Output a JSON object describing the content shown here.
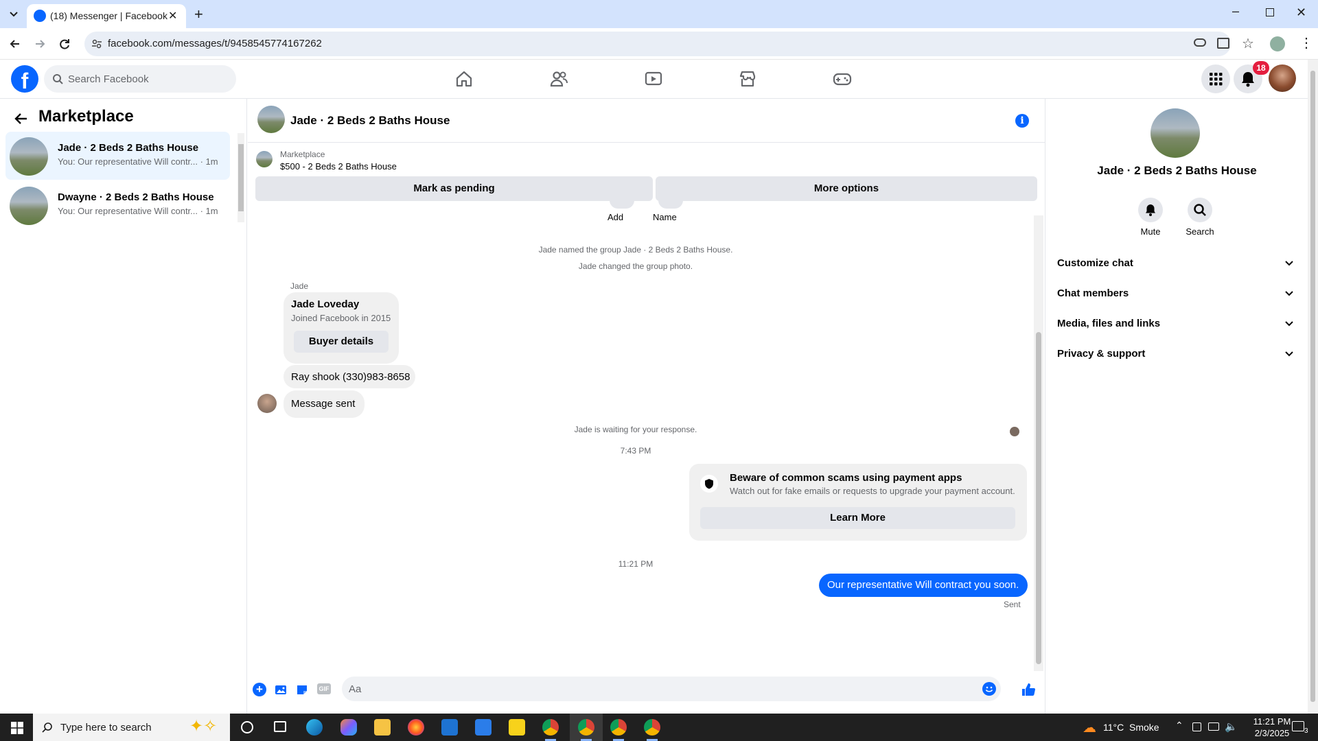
{
  "browser": {
    "tab_title": "(18) Messenger | Facebook",
    "url": "facebook.com/messages/t/9458545774167262"
  },
  "fb": {
    "search_placeholder": "Search Facebook",
    "notification_count": "18",
    "nav_icons": [
      "home-icon",
      "friends-icon",
      "video-icon",
      "marketplace-icon",
      "gaming-icon"
    ]
  },
  "left": {
    "title": "Marketplace",
    "conversations": [
      {
        "name": "Jade · 2 Beds 2 Baths House",
        "preview": "You: Our representative Will contr... · 1m"
      },
      {
        "name": "Dwayne · 2 Beds 2 Baths House",
        "preview": "You: Our representative Will contr... · 1m"
      }
    ]
  },
  "chat": {
    "title": "Jade · 2 Beds 2 Baths House",
    "marketplace_label": "Marketplace",
    "listing": "$500 - 2 Beds 2 Baths House",
    "mark_pending": "Mark as pending",
    "more_options": "More options",
    "add_label": "Add",
    "name_label": "Name",
    "sys_named": "Jade named the group Jade · 2 Beds 2 Baths House.",
    "sys_photo": "Jade changed the group photo.",
    "sender": "Jade",
    "profile_name": "Jade Loveday",
    "profile_joined": "Joined Facebook in 2015",
    "buyer_details": "Buyer details",
    "msg1": "Ray shook (330)983-8658",
    "msg2": "Message sent",
    "waiting": "Jade is waiting for your response.",
    "time1": "7:43 PM",
    "scam_title": "Beware of common scams using payment apps",
    "scam_body": "Watch out for fake emails or requests to upgrade your payment account.",
    "learn_more": "Learn More",
    "time2": "11:21 PM",
    "outgoing": "Our representative Will contract you soon.",
    "sent_label": "Sent",
    "composer_placeholder": "Aa"
  },
  "right": {
    "name": "Jade · 2 Beds 2 Baths House",
    "mute": "Mute",
    "search": "Search",
    "sections": [
      "Customize chat",
      "Chat members",
      "Media, files and links",
      "Privacy & support"
    ]
  },
  "taskbar": {
    "search_placeholder": "Type here to search",
    "weather": "11°C  Smoke",
    "time": "11:21 PM",
    "date": "2/3/2025",
    "notif_count": "3"
  },
  "colors": {
    "accent": "#0866ff",
    "badge": "#e41e3f",
    "selected": "#ebf5ff"
  }
}
